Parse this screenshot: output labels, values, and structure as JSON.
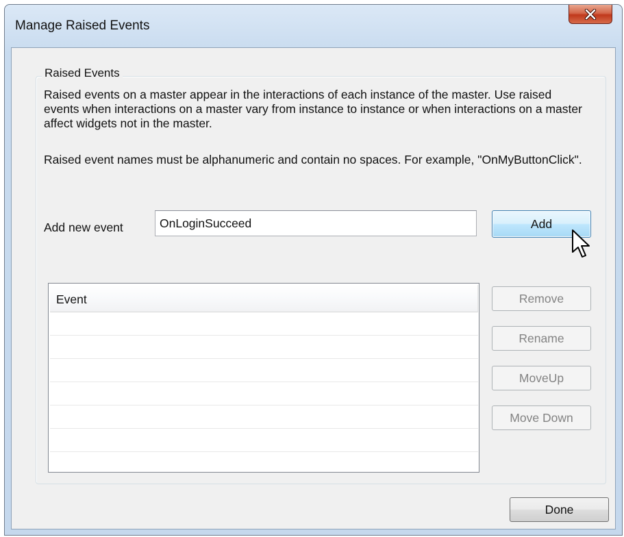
{
  "window": {
    "title": "Manage Raised Events",
    "close_icon": "close-icon"
  },
  "group": {
    "legend": "Raised Events",
    "description_1": "Raised events on a master appear in the interactions of each instance of the master. Use raised events when interactions on a master vary from instance to instance or when interactions on a master affect widgets not in the master.",
    "description_2": "Raised event names must be alphanumeric and contain no spaces. For example, \"OnMyButtonClick\"."
  },
  "add_event": {
    "label": "Add new event",
    "input_value": "OnLoginSucceed",
    "add_button": "Add"
  },
  "events_table": {
    "columns": [
      "Event"
    ],
    "rows": []
  },
  "side_buttons": {
    "remove": "Remove",
    "rename": "Rename",
    "move_up": "MoveUp",
    "move_down": "Move Down"
  },
  "footer": {
    "done_button": "Done"
  },
  "colors": {
    "title_gradient_top": "#dbe8f6",
    "close_button_red": "#c0391c",
    "add_button_hover": "#bee6fd",
    "disabled_text": "#838383"
  },
  "cursor_icon": "mouse-pointer-icon"
}
